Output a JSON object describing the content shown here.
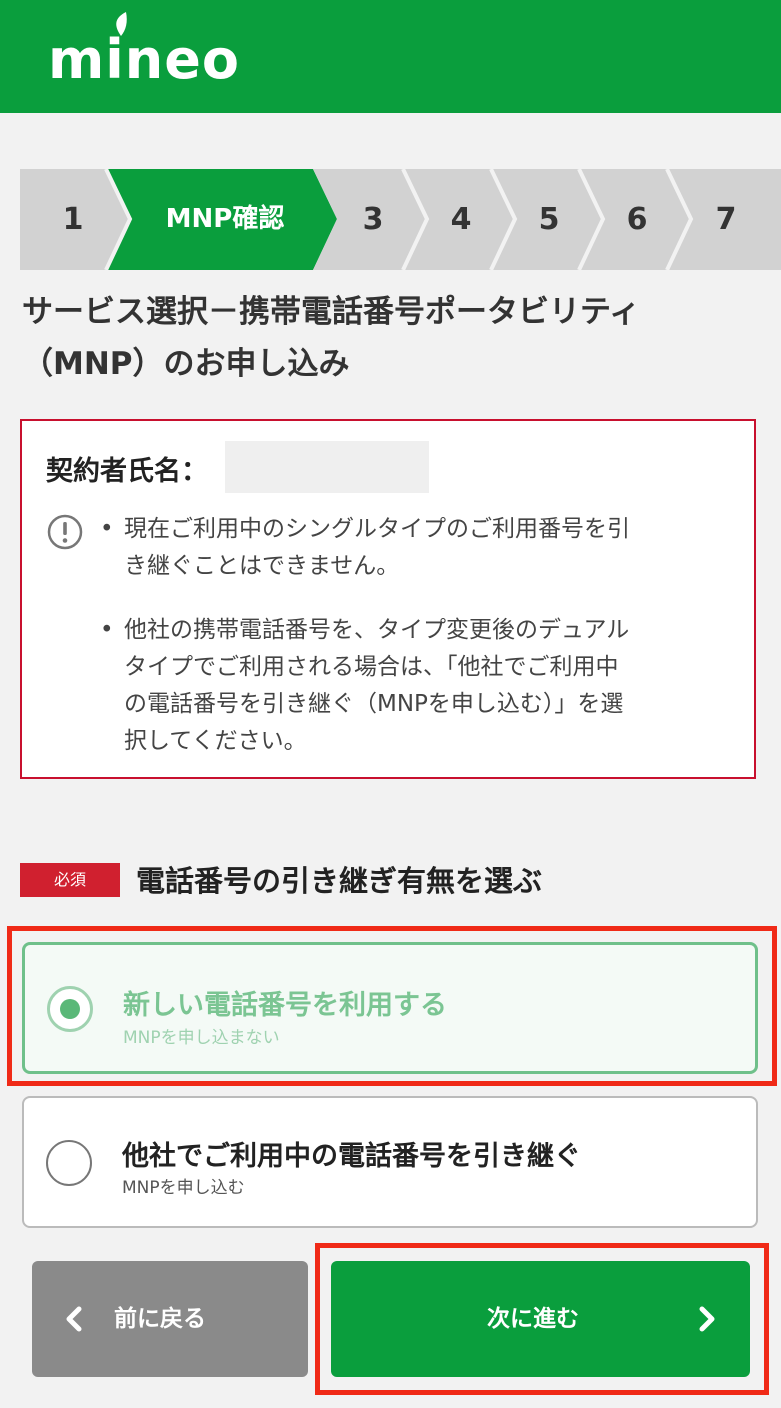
{
  "header": {
    "logo_text": "mineo",
    "brand_color": "#0a9e3d"
  },
  "stepper": {
    "steps": [
      {
        "label": "1",
        "active": false
      },
      {
        "label": "MNP確認",
        "active": true
      },
      {
        "label": "3",
        "active": false
      },
      {
        "label": "4",
        "active": false
      },
      {
        "label": "5",
        "active": false
      },
      {
        "label": "6",
        "active": false
      },
      {
        "label": "7",
        "active": false
      }
    ],
    "active_color": "#0a9e3d",
    "inactive_color": "#d2d2d2"
  },
  "page": {
    "title_line1": "サービス選択－携帯電話番号ポータビリティ",
    "title_line2": "（MNP）のお申し込み"
  },
  "notice": {
    "name_label": "契約者氏名：",
    "bullet_mark": "•",
    "icon": "exclamation-circle-icon",
    "items": [
      {
        "lines": [
          "現在ご利用中のシングルタイプのご利用番号を引",
          "き継ぐことはできません。"
        ]
      },
      {
        "lines": [
          "他社の携帯電話番号を、タイプ変更後のデュアル",
          "タイプでご利用される場合は、「他社でご利用中",
          "の電話番号を引き継ぐ（MNPを申し込む）」を選",
          "択してください。"
        ]
      }
    ],
    "border_color": "#c8102e"
  },
  "section": {
    "required_badge": "必須",
    "title": "電話番号の引き継ぎ有無を選ぶ"
  },
  "options": [
    {
      "main": "新しい電話番号を利用する",
      "sub": "MNPを申し込まない",
      "selected": true
    },
    {
      "main": "他社でご利用中の電話番号を引き継ぐ",
      "sub": "MNPを申し込む",
      "selected": false
    }
  ],
  "buttons": {
    "back_label": "前に戻る",
    "next_label": "次に進む"
  },
  "highlight_color": "#f02a17"
}
